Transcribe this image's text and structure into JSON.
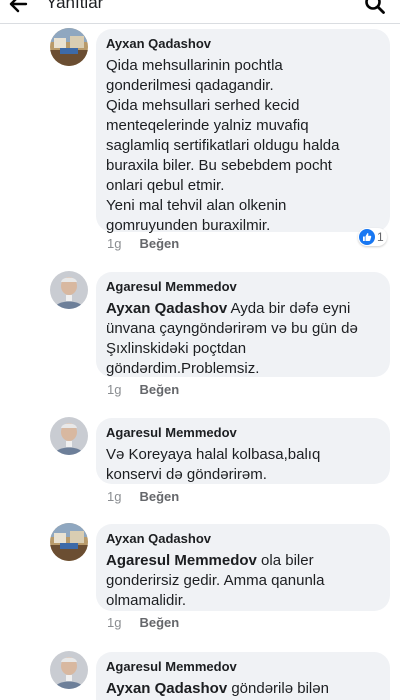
{
  "header": {
    "title": "Yanıtlar"
  },
  "colors": {
    "bubble": "#f0f2f5",
    "like_blue": "#1877f2"
  },
  "comments": [
    {
      "author": "Ayxan Qadashov",
      "lines": [
        "Qida mehsullarinin pochtla",
        "gonderilmesi qadagandir.",
        "Qida mehsullari serhed kecid",
        "menteqelerinde yalniz muvafiq",
        "saglamliq sertifikatlari oldugu halda",
        "buraxila biler. Bu sebebdem pocht",
        "onlari qebul etmir.",
        "Yeni mal tehvil alan olkenin",
        "gomruyunden buraxilmir."
      ],
      "time": "1g",
      "like": "Beğen",
      "reaction_count": "1"
    },
    {
      "author": "Agaresul Memmedov",
      "mention": "Ayxan Qadashov",
      "first_line_rest": " Ayda bir dəfə eyni",
      "lines": [
        "ünvana çayngöndərirəm və bu gün də",
        "Şıxlinskidəki poçtdan",
        "göndərdim.Problemsiz."
      ],
      "time": "1g",
      "like": "Beğen"
    },
    {
      "author": "Agaresul Memmedov",
      "lines": [
        "Və Koreyaya halal kolbasa,balıq",
        "konservi də göndərirəm."
      ],
      "time": "1g",
      "like": "Beğen"
    },
    {
      "author": "Ayxan Qadashov",
      "mention": "Agaresul Memmedov",
      "first_line_rest": " ola biler",
      "lines": [
        "gonderirsiz gedir. Amma qanunla",
        "olmamalidir."
      ],
      "time": "1g",
      "like": "Beğen"
    },
    {
      "author": "Agaresul Memmedov",
      "mention": "Ayxan Qadashov",
      "first_line_rest": " göndərilə bilən"
    }
  ]
}
